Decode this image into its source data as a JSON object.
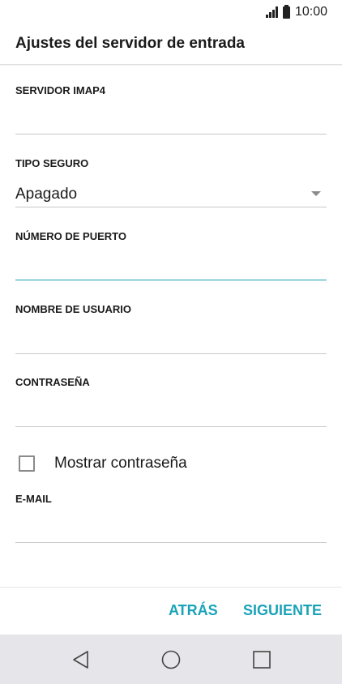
{
  "status_bar": {
    "time": "10:00",
    "icons": [
      "signal-icon",
      "battery-icon"
    ]
  },
  "header": {
    "title": "Ajustes del servidor de entrada"
  },
  "form": {
    "server": {
      "label": "SERVIDOR IMAP4",
      "value": ""
    },
    "security": {
      "label": "TIPO SEGURO",
      "value": "Apagado"
    },
    "port": {
      "label": "NÚMERO DE PUERTO",
      "value": ""
    },
    "username": {
      "label": "NOMBRE DE USUARIO",
      "value": ""
    },
    "password": {
      "label": "CONTRASEÑA",
      "value": ""
    },
    "show_password": {
      "label": "Mostrar contraseña",
      "checked": false
    },
    "email": {
      "label": "E-MAIL",
      "value": ""
    }
  },
  "footer": {
    "back_label": "ATRÁS",
    "next_label": "SIGUIENTE"
  },
  "nav_bar": {
    "icons": [
      "back-icon",
      "home-icon",
      "recent-apps-icon"
    ]
  },
  "colors": {
    "accent": "#1aa3b8",
    "nav_background": "#e6e6ea"
  }
}
